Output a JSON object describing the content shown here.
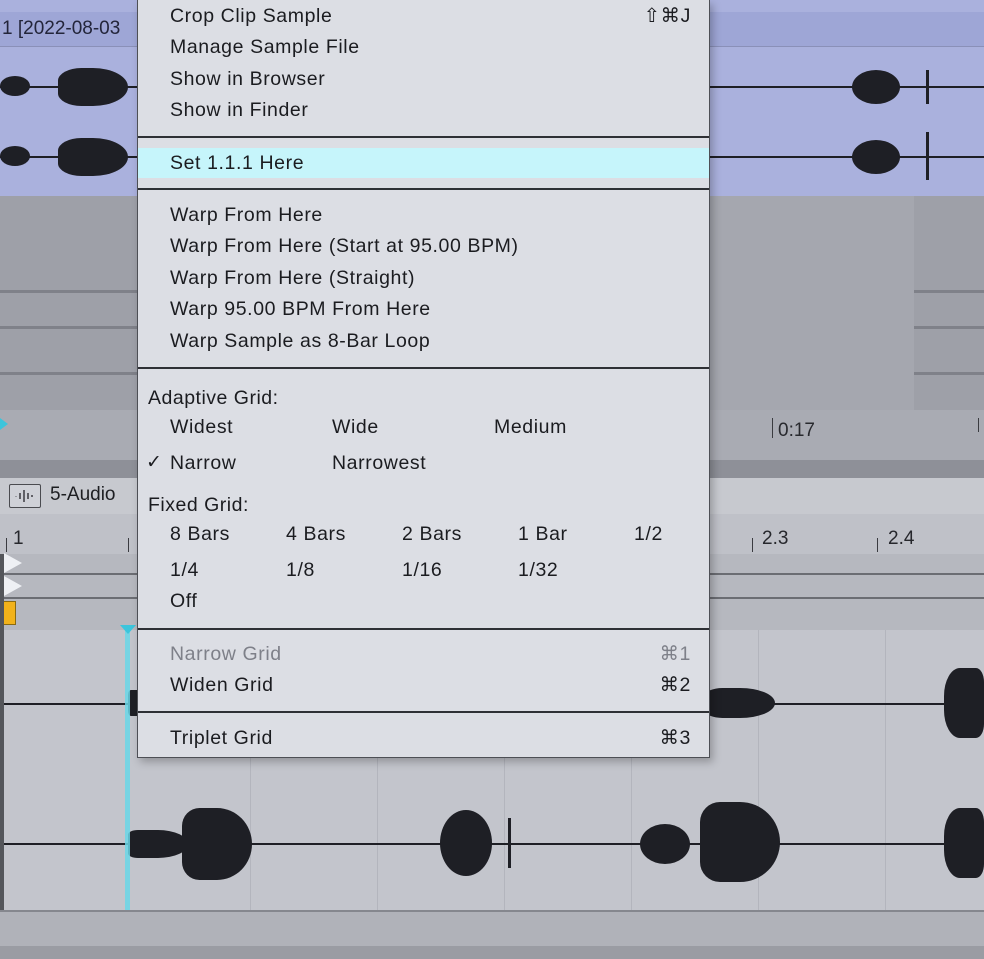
{
  "arrangement": {
    "top_clip_title": "1 [2022-08-03",
    "time_marker": "0:17"
  },
  "detail_view": {
    "clip_name": "5-Audio",
    "ruler_labels": [
      "1",
      "2.3",
      "2.4"
    ]
  },
  "context_menu": {
    "section1": [
      {
        "label": "Crop Clip Sample",
        "shortcut": "⇧⌘J"
      },
      {
        "label": "Manage Sample File",
        "shortcut": ""
      },
      {
        "label": "Show in Browser",
        "shortcut": ""
      },
      {
        "label": "Show in Finder",
        "shortcut": ""
      }
    ],
    "section2": [
      {
        "label": "Set 1.1.1 Here",
        "highlighted": true
      }
    ],
    "section3": [
      {
        "label": "Warp From Here"
      },
      {
        "label": "Warp From Here (Start at 95.00 BPM)"
      },
      {
        "label": "Warp From Here (Straight)"
      },
      {
        "label": "Warp 95.00 BPM From Here"
      },
      {
        "label": "Warp Sample as 8-Bar Loop"
      }
    ],
    "adaptive_grid": {
      "header": "Adaptive Grid:",
      "options": [
        "Widest",
        "Wide",
        "Medium",
        "Narrow",
        "Narrowest"
      ],
      "selected": "Narrow",
      "check_mark": "✓"
    },
    "fixed_grid": {
      "header": "Fixed Grid:",
      "options": [
        "8 Bars",
        "4 Bars",
        "2 Bars",
        "1 Bar",
        "1/2",
        "1/4",
        "1/8",
        "1/16",
        "1/32",
        "Off"
      ]
    },
    "section5": [
      {
        "label": "Narrow Grid",
        "shortcut": "⌘1",
        "disabled": true
      },
      {
        "label": "Widen Grid",
        "shortcut": "⌘2",
        "disabled": false
      }
    ],
    "section6": [
      {
        "label": "Triplet Grid",
        "shortcut": "⌘3"
      }
    ]
  },
  "colors": {
    "menu_bg": "#dcdee4",
    "highlight": "#c6f5fb",
    "clip_blue": "#aab1dd",
    "playhead": "#6ad6e6",
    "marker_yellow": "#f2b21a"
  }
}
